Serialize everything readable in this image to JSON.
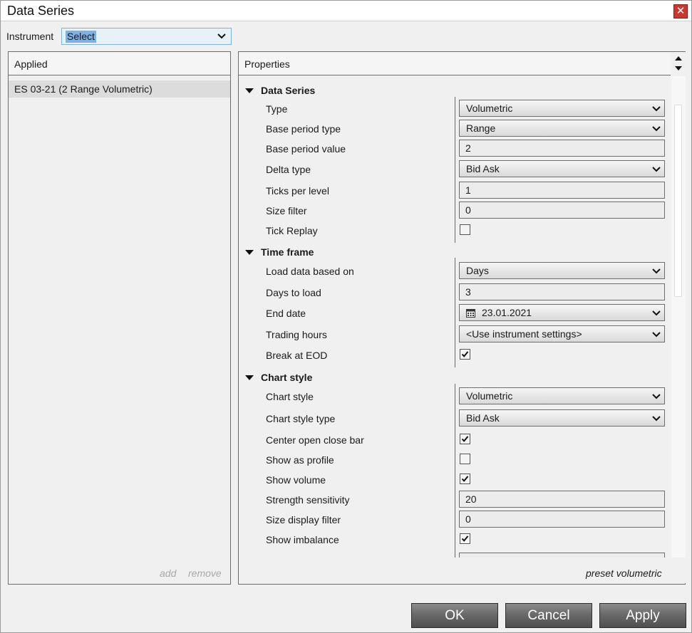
{
  "window": {
    "title": "Data Series",
    "close_glyph": "✕"
  },
  "instrument": {
    "label": "Instrument",
    "value": "Select"
  },
  "applied": {
    "header": "Applied",
    "items": [
      "ES 03-21 (2 Range Volumetric)"
    ],
    "add_label": "add",
    "remove_label": "remove"
  },
  "properties": {
    "header": "Properties",
    "preset_label": "preset volumetric",
    "categories": [
      {
        "label": "Data Series"
      },
      {
        "label": "Time frame"
      },
      {
        "label": "Chart style"
      }
    ],
    "rows": [
      {
        "label": "Type",
        "kind": "dropdown",
        "value": "Volumetric"
      },
      {
        "label": "Base period type",
        "kind": "dropdown",
        "value": "Range"
      },
      {
        "label": "Base period value",
        "kind": "text",
        "value": "2"
      },
      {
        "label": "Delta type",
        "kind": "dropdown",
        "value": "Bid Ask"
      },
      {
        "label": "Ticks per level",
        "kind": "text",
        "value": "1"
      },
      {
        "label": "Size filter",
        "kind": "text",
        "value": "0"
      },
      {
        "label": "Tick Replay",
        "kind": "checkbox",
        "checked": false
      },
      {
        "label": "Load data based on",
        "kind": "dropdown",
        "value": "Days"
      },
      {
        "label": "Days to load",
        "kind": "text",
        "value": "3"
      },
      {
        "label": "End date",
        "kind": "date",
        "value": "23.01.2021",
        "icon": "calendar-icon"
      },
      {
        "label": "Trading hours",
        "kind": "dropdown",
        "value": "<Use instrument settings>"
      },
      {
        "label": "Break at EOD",
        "kind": "checkbox",
        "checked": true
      },
      {
        "label": "Chart style",
        "kind": "dropdown",
        "value": "Volumetric"
      },
      {
        "label": "Chart style type",
        "kind": "dropdown",
        "value": "Bid Ask"
      },
      {
        "label": "Center open close bar",
        "kind": "checkbox",
        "checked": true
      },
      {
        "label": "Show as profile",
        "kind": "checkbox",
        "checked": false
      },
      {
        "label": "Show volume",
        "kind": "checkbox",
        "checked": true
      },
      {
        "label": "Strength sensitivity",
        "kind": "text",
        "value": "20"
      },
      {
        "label": "Size display filter",
        "kind": "text",
        "value": "0"
      },
      {
        "label": "Show imbalance",
        "kind": "checkbox",
        "checked": true
      }
    ]
  },
  "buttons": {
    "ok": "OK",
    "cancel": "Cancel",
    "apply": "Apply"
  },
  "colors": {
    "selection": "#7fb1e3",
    "close_button": "#c9382f",
    "button_face": "#6a6a6a"
  }
}
